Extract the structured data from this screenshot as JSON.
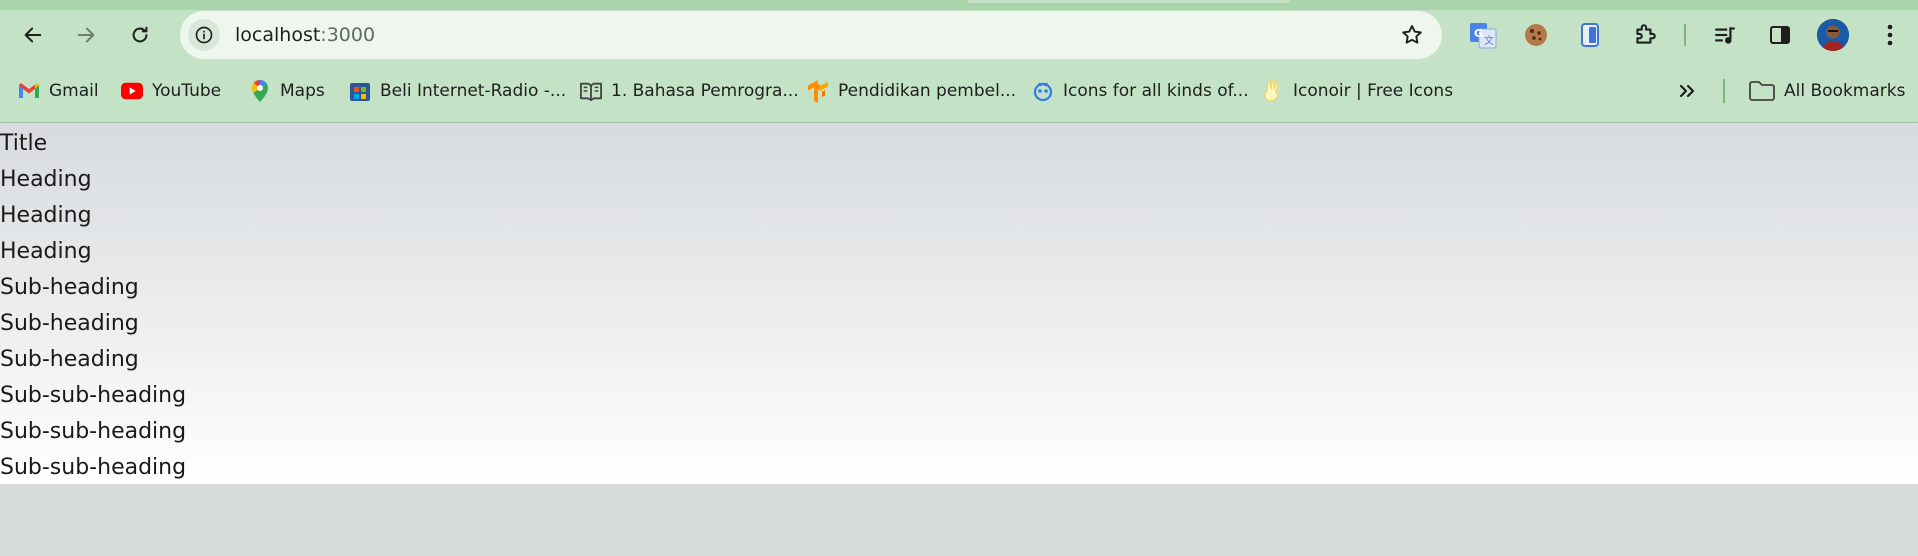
{
  "browser": {
    "address": {
      "host": "localhost",
      "port": ":3000"
    },
    "bookmarks": [
      {
        "label": "Gmail",
        "icon": "gmail-icon"
      },
      {
        "label": "YouTube",
        "icon": "youtube-icon"
      },
      {
        "label": "Maps",
        "icon": "maps-icon"
      },
      {
        "label": "Beli Internet-Radio -...",
        "icon": "store-icon"
      },
      {
        "label": "1. Bahasa Pemrogra...",
        "icon": "book-icon"
      },
      {
        "label": "Pendidikan pembel...",
        "icon": "tensorflow-icon"
      },
      {
        "label": "Icons for all kinds of...",
        "icon": "icon-library-icon"
      },
      {
        "label": "Iconoir | Free Icons",
        "icon": "iconoir-icon"
      }
    ],
    "all_bookmarks_label": "All Bookmarks",
    "colors": {
      "frame": "#c4e2c6",
      "omnibox": "#eef6ee",
      "accent": "#7bb57f"
    }
  },
  "page": {
    "lines": [
      "Title",
      "Heading",
      "Heading",
      "Heading",
      "Sub-heading",
      "Sub-heading",
      "Sub-heading",
      "Sub-sub-heading",
      "Sub-sub-heading",
      "Sub-sub-heading"
    ]
  }
}
